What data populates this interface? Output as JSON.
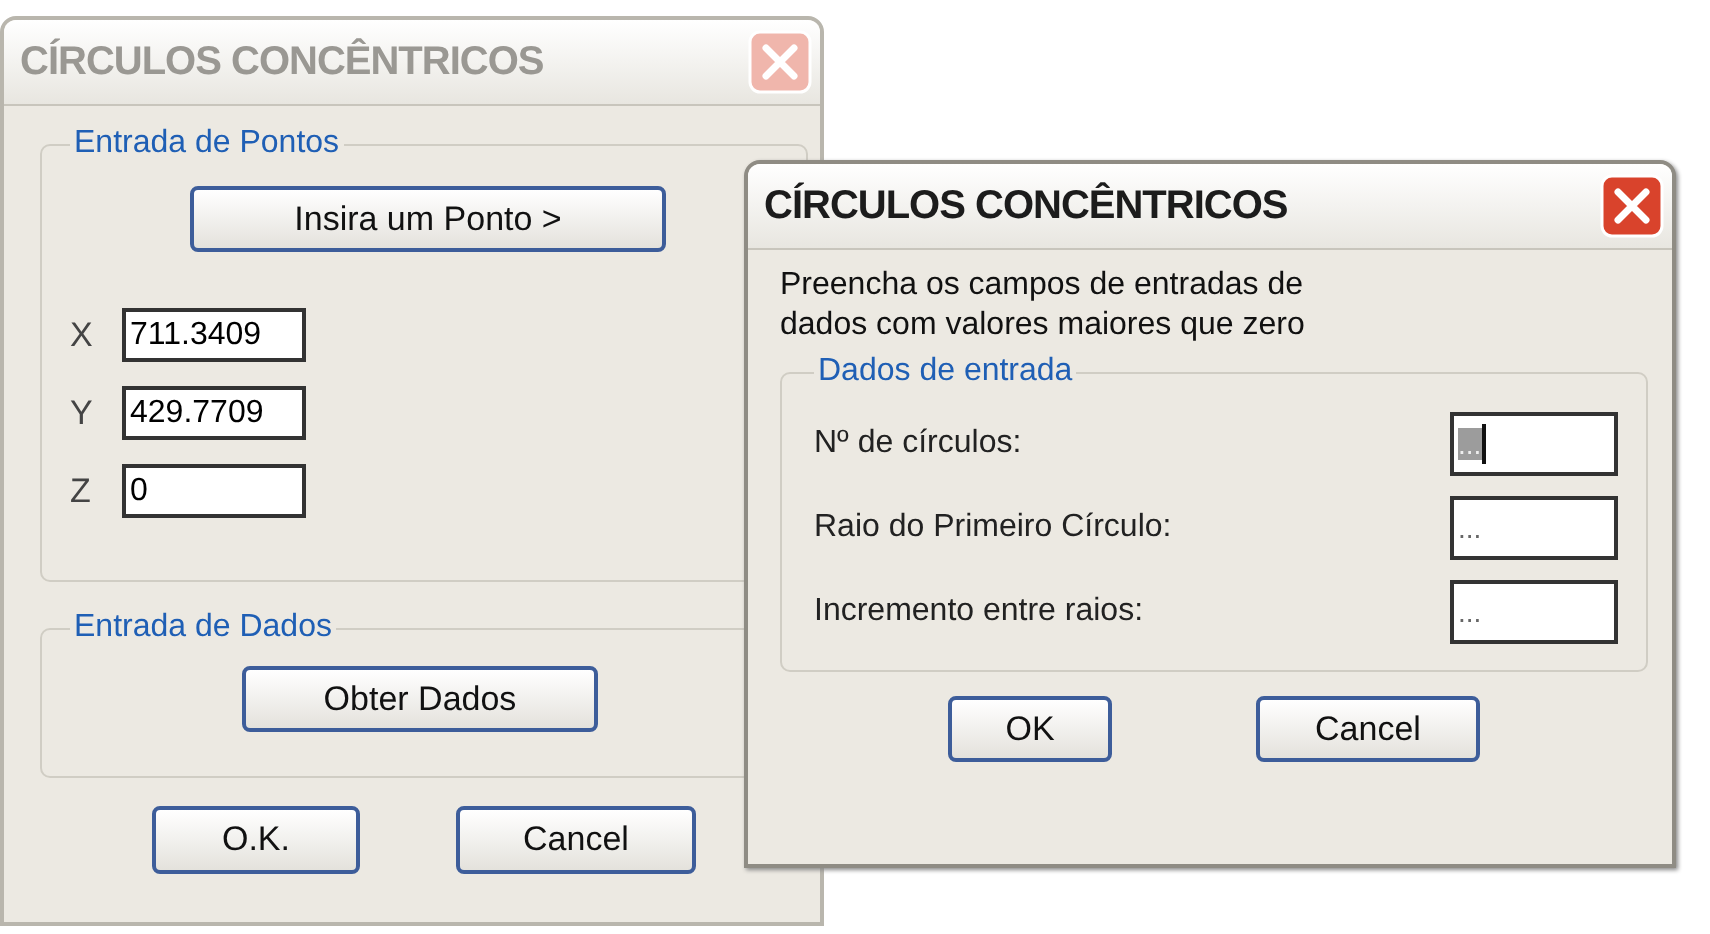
{
  "main_dialog": {
    "title": "CÍRCULOS CONCÊNTRICOS",
    "active": false,
    "points_group": {
      "label": "Entrada de Pontos",
      "insert_button": "Insira um Ponto >",
      "fields": [
        {
          "label": "X",
          "value": "711.3409"
        },
        {
          "label": "Y",
          "value": "429.7709"
        },
        {
          "label": "Z",
          "value": "0"
        }
      ]
    },
    "data_group": {
      "label": "Entrada de Dados",
      "button": "Obter Dados"
    },
    "buttons": [
      "O.K.",
      "Cancel"
    ]
  },
  "input_dialog": {
    "title": "CÍRCULOS CONCÊNTRICOS",
    "active": true,
    "message": "Preencha os campos de entradas de\ndados com valores maiores que zero",
    "group": {
      "label": "Dados de entrada",
      "rows": [
        {
          "label": "Nº de círculos:",
          "value": "...",
          "focused": true
        },
        {
          "label": "Raio do Primeiro Círculo:",
          "value": "...",
          "focused": false
        },
        {
          "label": "Incremento entre raios:",
          "value": "...",
          "focused": false
        }
      ]
    },
    "buttons": [
      "OK",
      "Cancel"
    ]
  }
}
